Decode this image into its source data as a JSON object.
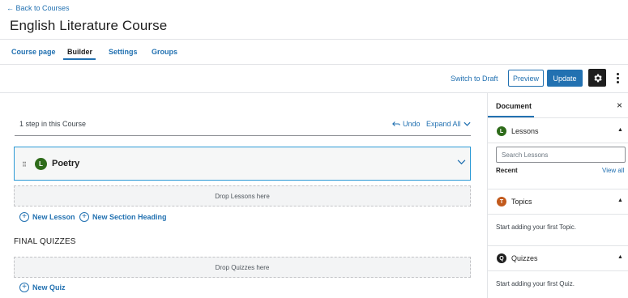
{
  "header": {
    "back_link": "← Back to Courses",
    "title": "English Literature Course"
  },
  "tabs": [
    {
      "label": "Course page",
      "active": false
    },
    {
      "label": "Builder",
      "active": true
    },
    {
      "label": "Settings",
      "active": false
    },
    {
      "label": "Groups",
      "active": false
    }
  ],
  "toolbar": {
    "switch_draft": "Switch to Draft",
    "preview": "Preview",
    "update": "Update",
    "settings_icon": "gear-icon",
    "more_icon": "vertical-ellipsis-icon"
  },
  "builder": {
    "steps_count": "1 step in this Course",
    "undo": "Undo",
    "expand_all": "Expand All",
    "lessons": [
      {
        "badge": "L",
        "title": "Poetry"
      }
    ],
    "drop_lessons": "Drop Lessons here",
    "new_lesson": "New Lesson",
    "new_section": "New Section Heading",
    "final_quizzes_heading": "FINAL QUIZZES",
    "drop_quizzes": "Drop Quizzes here",
    "new_quiz": "New Quiz"
  },
  "sidebar": {
    "tab": "Document",
    "close": "×",
    "lessons": {
      "badge": "L",
      "title": "Lessons",
      "search_placeholder": "Search Lessons",
      "recent": "Recent",
      "view_all": "View all"
    },
    "topics": {
      "badge": "T",
      "title": "Topics",
      "empty": "Start adding your first Topic."
    },
    "quizzes": {
      "badge": "Q",
      "title": "Quizzes",
      "empty": "Start adding your first Quiz."
    }
  },
  "colors": {
    "accent": "#2271b1",
    "lesson_badge": "#2e6b1a",
    "topic_badge": "#c25a1c",
    "quiz_badge": "#1e1e1e",
    "active_border": "#2c9ad6"
  }
}
